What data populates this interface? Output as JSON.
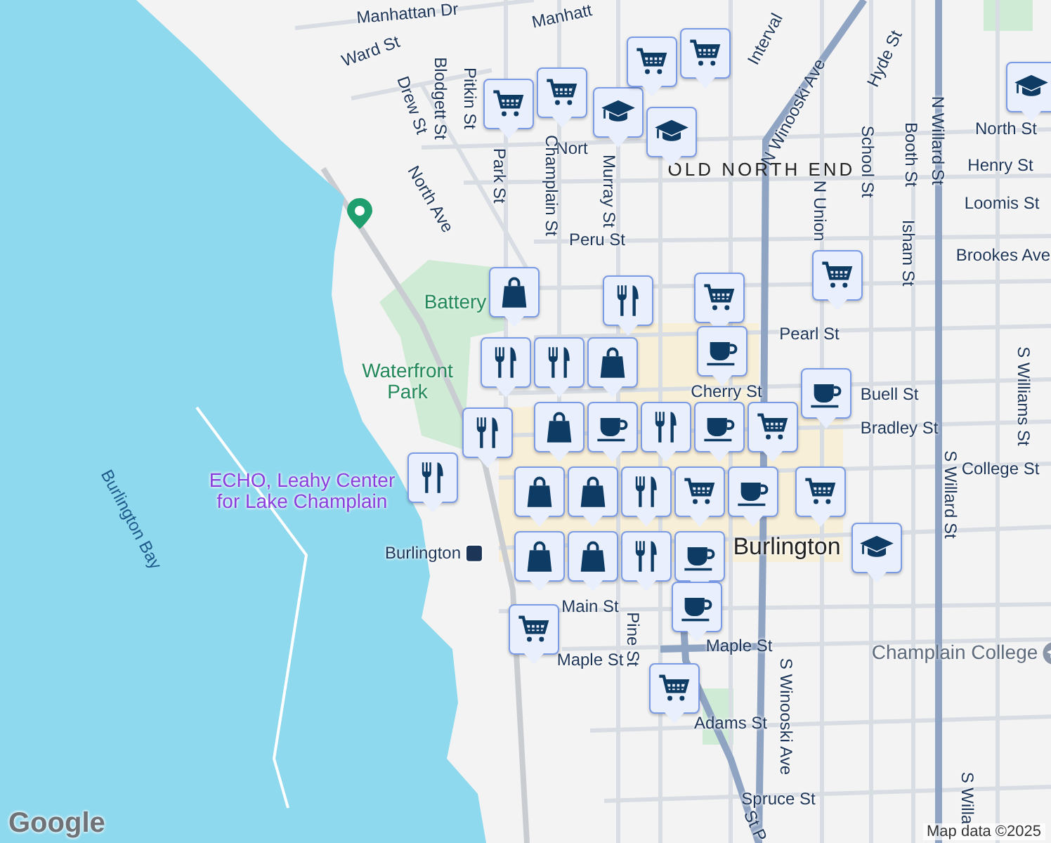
{
  "map": {
    "labels": [
      {
        "text": "Manhattan Dr",
        "kind": "street"
      },
      {
        "text": "Manhatt",
        "kind": "street"
      },
      {
        "text": "Interval",
        "kind": "street"
      },
      {
        "text": "Ward St",
        "kind": "street"
      },
      {
        "text": "Drew St",
        "kind": "street"
      },
      {
        "text": "Blodgett St",
        "kind": "street"
      },
      {
        "text": "Pitkin St",
        "kind": "street"
      },
      {
        "text": "N Winooski Ave",
        "kind": "street"
      },
      {
        "text": "Hyde St",
        "kind": "street"
      },
      {
        "text": "N Willard St",
        "kind": "street"
      },
      {
        "text": "North St",
        "kind": "street"
      },
      {
        "text": "Nort",
        "kind": "street"
      },
      {
        "text": "Park St",
        "kind": "street"
      },
      {
        "text": "Champlain St",
        "kind": "street"
      },
      {
        "text": "Murray St",
        "kind": "street"
      },
      {
        "text": "OLD NORTH END",
        "kind": "area"
      },
      {
        "text": "School St",
        "kind": "street"
      },
      {
        "text": "Booth St",
        "kind": "street"
      },
      {
        "text": "Henry St",
        "kind": "street"
      },
      {
        "text": "Loomis St",
        "kind": "street"
      },
      {
        "text": "North Ave",
        "kind": "street"
      },
      {
        "text": "N Union",
        "kind": "street"
      },
      {
        "text": "Isham St",
        "kind": "street"
      },
      {
        "text": "Peru St",
        "kind": "street"
      },
      {
        "text": "Brookes Ave",
        "kind": "street"
      },
      {
        "text": "Battery",
        "kind": "park"
      },
      {
        "text": "Pearl St",
        "kind": "street"
      },
      {
        "text": "Waterfront Park",
        "kind": "park"
      },
      {
        "text": "Cherry St",
        "kind": "street"
      },
      {
        "text": "Buell St",
        "kind": "street"
      },
      {
        "text": "Bradley St",
        "kind": "street"
      },
      {
        "text": "S Willard St",
        "kind": "street"
      },
      {
        "text": "S Williams St",
        "kind": "street"
      },
      {
        "text": "College St",
        "kind": "street"
      },
      {
        "text": "ECHO, Leahy Center for Lake Champlain",
        "kind": "poi"
      },
      {
        "text": "Burlington",
        "kind": "station"
      },
      {
        "text": "Burlington",
        "kind": "city"
      },
      {
        "text": "Main St",
        "kind": "street"
      },
      {
        "text": "Pine St",
        "kind": "street"
      },
      {
        "text": "Maple St",
        "kind": "street"
      },
      {
        "text": "Maple St",
        "kind": "street"
      },
      {
        "text": "Champlain College",
        "kind": "school"
      },
      {
        "text": "S Winooski Ave",
        "kind": "street"
      },
      {
        "text": "Adams St",
        "kind": "street"
      },
      {
        "text": "Spruce St",
        "kind": "street"
      },
      {
        "text": "St P",
        "kind": "street"
      },
      {
        "text": "S Willa",
        "kind": "street"
      },
      {
        "text": "Burlington Bay",
        "kind": "water"
      }
    ],
    "pins": [
      {
        "kind": "cart"
      },
      {
        "kind": "cart"
      },
      {
        "kind": "cap"
      },
      {
        "kind": "cart"
      },
      {
        "kind": "cart"
      },
      {
        "kind": "cap"
      },
      {
        "kind": "cap"
      },
      {
        "kind": "bag"
      },
      {
        "kind": "fork"
      },
      {
        "kind": "cart"
      },
      {
        "kind": "cup"
      },
      {
        "kind": "cart"
      },
      {
        "kind": "fork"
      },
      {
        "kind": "fork"
      },
      {
        "kind": "bag"
      },
      {
        "kind": "bag"
      },
      {
        "kind": "cup"
      },
      {
        "kind": "cup"
      },
      {
        "kind": "fork"
      },
      {
        "kind": "fork"
      },
      {
        "kind": "fork"
      },
      {
        "kind": "cup"
      },
      {
        "kind": "cart"
      },
      {
        "kind": "bag"
      },
      {
        "kind": "bag"
      },
      {
        "kind": "fork"
      },
      {
        "kind": "cart"
      },
      {
        "kind": "cup"
      },
      {
        "kind": "cart"
      },
      {
        "kind": "cap"
      },
      {
        "kind": "bag"
      },
      {
        "kind": "bag"
      },
      {
        "kind": "fork"
      },
      {
        "kind": "cup"
      },
      {
        "kind": "cup"
      },
      {
        "kind": "cart"
      },
      {
        "kind": "cart"
      }
    ],
    "logo": "Google",
    "attribution": "Map data ©2025"
  }
}
